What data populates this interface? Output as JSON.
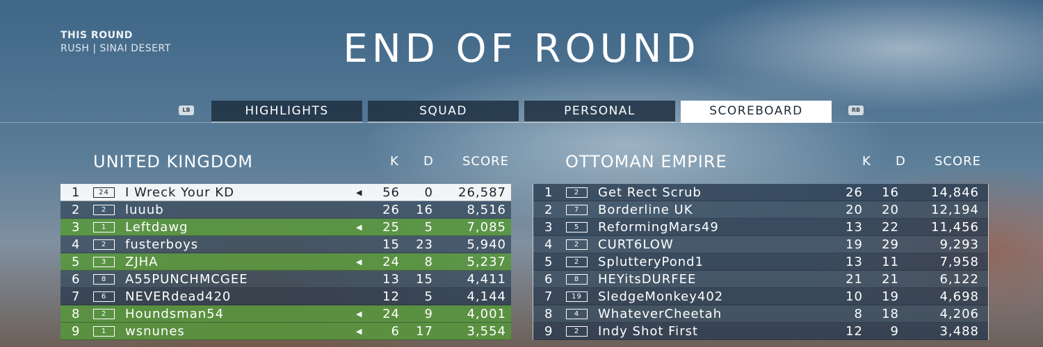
{
  "round": {
    "label": "THIS ROUND",
    "mode_map": "RUSH | SINAI DESERT"
  },
  "title": "END OF ROUND",
  "bumpers": {
    "left": "LB",
    "right": "RB"
  },
  "tabs": [
    {
      "label": "HIGHLIGHTS",
      "active": false
    },
    {
      "label": "SQUAD",
      "active": false
    },
    {
      "label": "PERSONAL",
      "active": false
    },
    {
      "label": "SCOREBOARD",
      "active": true
    }
  ],
  "columns": {
    "k": "K",
    "d": "D",
    "score": "SCORE"
  },
  "teams": [
    {
      "name": "UNITED KINGDOM",
      "players": [
        {
          "pos": "1",
          "rank": "24",
          "name": "I Wreck Your KD",
          "k": "56",
          "d": "0",
          "score": "26,587",
          "speaking": true,
          "highlight": "me"
        },
        {
          "pos": "2",
          "rank": "2",
          "name": "luuub",
          "k": "26",
          "d": "16",
          "score": "8,516",
          "speaking": false,
          "highlight": ""
        },
        {
          "pos": "3",
          "rank": "1",
          "name": "Leftdawg",
          "k": "25",
          "d": "5",
          "score": "7,085",
          "speaking": true,
          "highlight": "squad"
        },
        {
          "pos": "4",
          "rank": "2",
          "name": "fusterboys",
          "k": "15",
          "d": "23",
          "score": "5,940",
          "speaking": false,
          "highlight": ""
        },
        {
          "pos": "5",
          "rank": "3",
          "name": "ZJHA",
          "k": "24",
          "d": "8",
          "score": "5,237",
          "speaking": true,
          "highlight": "squad"
        },
        {
          "pos": "6",
          "rank": "8",
          "name": "A55PUNCHMCGEE",
          "k": "13",
          "d": "15",
          "score": "4,411",
          "speaking": false,
          "highlight": ""
        },
        {
          "pos": "7",
          "rank": "6",
          "name": "NEVERdead420",
          "k": "12",
          "d": "5",
          "score": "4,144",
          "speaking": false,
          "highlight": ""
        },
        {
          "pos": "8",
          "rank": "2",
          "name": "Houndsman54",
          "k": "24",
          "d": "9",
          "score": "4,001",
          "speaking": true,
          "highlight": "squad"
        },
        {
          "pos": "9",
          "rank": "1",
          "name": "wsnunes",
          "k": "6",
          "d": "17",
          "score": "3,554",
          "speaking": true,
          "highlight": "squad"
        }
      ]
    },
    {
      "name": "OTTOMAN EMPIRE",
      "players": [
        {
          "pos": "1",
          "rank": "2",
          "name": "Get Rect Scrub",
          "k": "26",
          "d": "16",
          "score": "14,846",
          "speaking": false,
          "highlight": ""
        },
        {
          "pos": "2",
          "rank": "7",
          "name": "Borderline UK",
          "k": "20",
          "d": "20",
          "score": "12,194",
          "speaking": false,
          "highlight": ""
        },
        {
          "pos": "3",
          "rank": "5",
          "name": "ReformingMars49",
          "k": "13",
          "d": "22",
          "score": "11,456",
          "speaking": false,
          "highlight": ""
        },
        {
          "pos": "4",
          "rank": "2",
          "name": "CURT6LOW",
          "k": "19",
          "d": "29",
          "score": "9,293",
          "speaking": false,
          "highlight": ""
        },
        {
          "pos": "5",
          "rank": "2",
          "name": "SplutteryPond1",
          "k": "13",
          "d": "11",
          "score": "7,958",
          "speaking": false,
          "highlight": ""
        },
        {
          "pos": "6",
          "rank": "8",
          "name": "HEYitsDURFEE",
          "k": "21",
          "d": "21",
          "score": "6,122",
          "speaking": false,
          "highlight": ""
        },
        {
          "pos": "7",
          "rank": "19",
          "name": "SledgeMonkey402",
          "k": "10",
          "d": "19",
          "score": "4,698",
          "speaking": false,
          "highlight": ""
        },
        {
          "pos": "8",
          "rank": "4",
          "name": "WhateverCheetah",
          "k": "8",
          "d": "18",
          "score": "4,206",
          "speaking": false,
          "highlight": ""
        },
        {
          "pos": "9",
          "rank": "2",
          "name": "Indy Shot First",
          "k": "12",
          "d": "9",
          "score": "3,488",
          "speaking": false,
          "highlight": ""
        }
      ]
    }
  ]
}
